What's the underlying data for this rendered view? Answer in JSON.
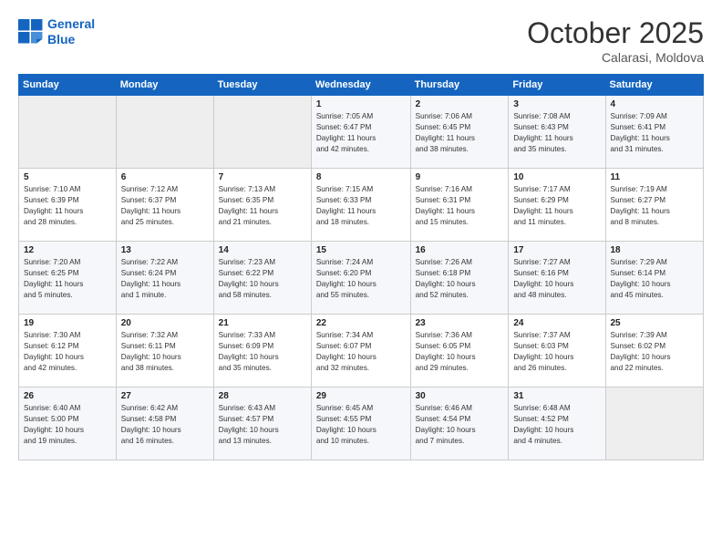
{
  "header": {
    "logo_line1": "General",
    "logo_line2": "Blue",
    "month": "October 2025",
    "location": "Calarasi, Moldova"
  },
  "weekdays": [
    "Sunday",
    "Monday",
    "Tuesday",
    "Wednesday",
    "Thursday",
    "Friday",
    "Saturday"
  ],
  "weeks": [
    [
      {
        "day": "",
        "info": ""
      },
      {
        "day": "",
        "info": ""
      },
      {
        "day": "",
        "info": ""
      },
      {
        "day": "1",
        "info": "Sunrise: 7:05 AM\nSunset: 6:47 PM\nDaylight: 11 hours\nand 42 minutes."
      },
      {
        "day": "2",
        "info": "Sunrise: 7:06 AM\nSunset: 6:45 PM\nDaylight: 11 hours\nand 38 minutes."
      },
      {
        "day": "3",
        "info": "Sunrise: 7:08 AM\nSunset: 6:43 PM\nDaylight: 11 hours\nand 35 minutes."
      },
      {
        "day": "4",
        "info": "Sunrise: 7:09 AM\nSunset: 6:41 PM\nDaylight: 11 hours\nand 31 minutes."
      }
    ],
    [
      {
        "day": "5",
        "info": "Sunrise: 7:10 AM\nSunset: 6:39 PM\nDaylight: 11 hours\nand 28 minutes."
      },
      {
        "day": "6",
        "info": "Sunrise: 7:12 AM\nSunset: 6:37 PM\nDaylight: 11 hours\nand 25 minutes."
      },
      {
        "day": "7",
        "info": "Sunrise: 7:13 AM\nSunset: 6:35 PM\nDaylight: 11 hours\nand 21 minutes."
      },
      {
        "day": "8",
        "info": "Sunrise: 7:15 AM\nSunset: 6:33 PM\nDaylight: 11 hours\nand 18 minutes."
      },
      {
        "day": "9",
        "info": "Sunrise: 7:16 AM\nSunset: 6:31 PM\nDaylight: 11 hours\nand 15 minutes."
      },
      {
        "day": "10",
        "info": "Sunrise: 7:17 AM\nSunset: 6:29 PM\nDaylight: 11 hours\nand 11 minutes."
      },
      {
        "day": "11",
        "info": "Sunrise: 7:19 AM\nSunset: 6:27 PM\nDaylight: 11 hours\nand 8 minutes."
      }
    ],
    [
      {
        "day": "12",
        "info": "Sunrise: 7:20 AM\nSunset: 6:25 PM\nDaylight: 11 hours\nand 5 minutes."
      },
      {
        "day": "13",
        "info": "Sunrise: 7:22 AM\nSunset: 6:24 PM\nDaylight: 11 hours\nand 1 minute."
      },
      {
        "day": "14",
        "info": "Sunrise: 7:23 AM\nSunset: 6:22 PM\nDaylight: 10 hours\nand 58 minutes."
      },
      {
        "day": "15",
        "info": "Sunrise: 7:24 AM\nSunset: 6:20 PM\nDaylight: 10 hours\nand 55 minutes."
      },
      {
        "day": "16",
        "info": "Sunrise: 7:26 AM\nSunset: 6:18 PM\nDaylight: 10 hours\nand 52 minutes."
      },
      {
        "day": "17",
        "info": "Sunrise: 7:27 AM\nSunset: 6:16 PM\nDaylight: 10 hours\nand 48 minutes."
      },
      {
        "day": "18",
        "info": "Sunrise: 7:29 AM\nSunset: 6:14 PM\nDaylight: 10 hours\nand 45 minutes."
      }
    ],
    [
      {
        "day": "19",
        "info": "Sunrise: 7:30 AM\nSunset: 6:12 PM\nDaylight: 10 hours\nand 42 minutes."
      },
      {
        "day": "20",
        "info": "Sunrise: 7:32 AM\nSunset: 6:11 PM\nDaylight: 10 hours\nand 38 minutes."
      },
      {
        "day": "21",
        "info": "Sunrise: 7:33 AM\nSunset: 6:09 PM\nDaylight: 10 hours\nand 35 minutes."
      },
      {
        "day": "22",
        "info": "Sunrise: 7:34 AM\nSunset: 6:07 PM\nDaylight: 10 hours\nand 32 minutes."
      },
      {
        "day": "23",
        "info": "Sunrise: 7:36 AM\nSunset: 6:05 PM\nDaylight: 10 hours\nand 29 minutes."
      },
      {
        "day": "24",
        "info": "Sunrise: 7:37 AM\nSunset: 6:03 PM\nDaylight: 10 hours\nand 26 minutes."
      },
      {
        "day": "25",
        "info": "Sunrise: 7:39 AM\nSunset: 6:02 PM\nDaylight: 10 hours\nand 22 minutes."
      }
    ],
    [
      {
        "day": "26",
        "info": "Sunrise: 6:40 AM\nSunset: 5:00 PM\nDaylight: 10 hours\nand 19 minutes."
      },
      {
        "day": "27",
        "info": "Sunrise: 6:42 AM\nSunset: 4:58 PM\nDaylight: 10 hours\nand 16 minutes."
      },
      {
        "day": "28",
        "info": "Sunrise: 6:43 AM\nSunset: 4:57 PM\nDaylight: 10 hours\nand 13 minutes."
      },
      {
        "day": "29",
        "info": "Sunrise: 6:45 AM\nSunset: 4:55 PM\nDaylight: 10 hours\nand 10 minutes."
      },
      {
        "day": "30",
        "info": "Sunrise: 6:46 AM\nSunset: 4:54 PM\nDaylight: 10 hours\nand 7 minutes."
      },
      {
        "day": "31",
        "info": "Sunrise: 6:48 AM\nSunset: 4:52 PM\nDaylight: 10 hours\nand 4 minutes."
      },
      {
        "day": "",
        "info": ""
      }
    ]
  ]
}
